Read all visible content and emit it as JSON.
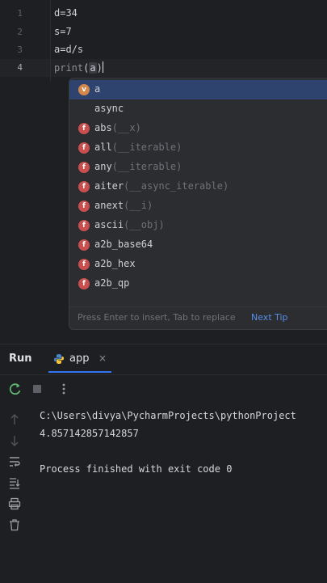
{
  "editor": {
    "lines": [
      {
        "num": "1",
        "text": "d=34"
      },
      {
        "num": "2",
        "text": "s=7"
      },
      {
        "num": "3",
        "text": "a=d/s"
      },
      {
        "num": "4",
        "fn": "print",
        "open": "(",
        "arg": "a",
        "close": ")"
      }
    ]
  },
  "completion": {
    "items": [
      {
        "icon": "v",
        "label": "a",
        "sig": ""
      },
      {
        "icon": "",
        "label": "async",
        "sig": ""
      },
      {
        "icon": "f",
        "label": "abs",
        "sig": "(__x)"
      },
      {
        "icon": "f",
        "label": "all",
        "sig": "(__iterable)"
      },
      {
        "icon": "f",
        "label": "any",
        "sig": "(__iterable)"
      },
      {
        "icon": "f",
        "label": "aiter",
        "sig": "(__async_iterable)"
      },
      {
        "icon": "f",
        "label": "anext",
        "sig": "(__i)"
      },
      {
        "icon": "f",
        "label": "ascii",
        "sig": "(__obj)"
      },
      {
        "icon": "f",
        "label": "a2b_base64",
        "sig": ""
      },
      {
        "icon": "f",
        "label": "a2b_hex",
        "sig": ""
      },
      {
        "icon": "f",
        "label": "a2b_qp",
        "sig": ""
      }
    ],
    "footer_hint": "Press Enter to insert, Tab to replace",
    "footer_link": "Next Tip"
  },
  "run": {
    "title": "Run",
    "tab_name": "app",
    "tab_close": "×",
    "output": [
      "C:\\Users\\divya\\PycharmProjects\\pythonProject",
      "4.857142857142857",
      "",
      "Process finished with exit code 0"
    ]
  },
  "colors": {
    "editor_bg": "#1e1f22",
    "popup_bg": "#2b2d30",
    "selection": "#2e436e",
    "function_icon": "#c94f4f",
    "variable_icon": "#d1884a",
    "link": "#5b8fe8",
    "accent": "#3574f0"
  }
}
